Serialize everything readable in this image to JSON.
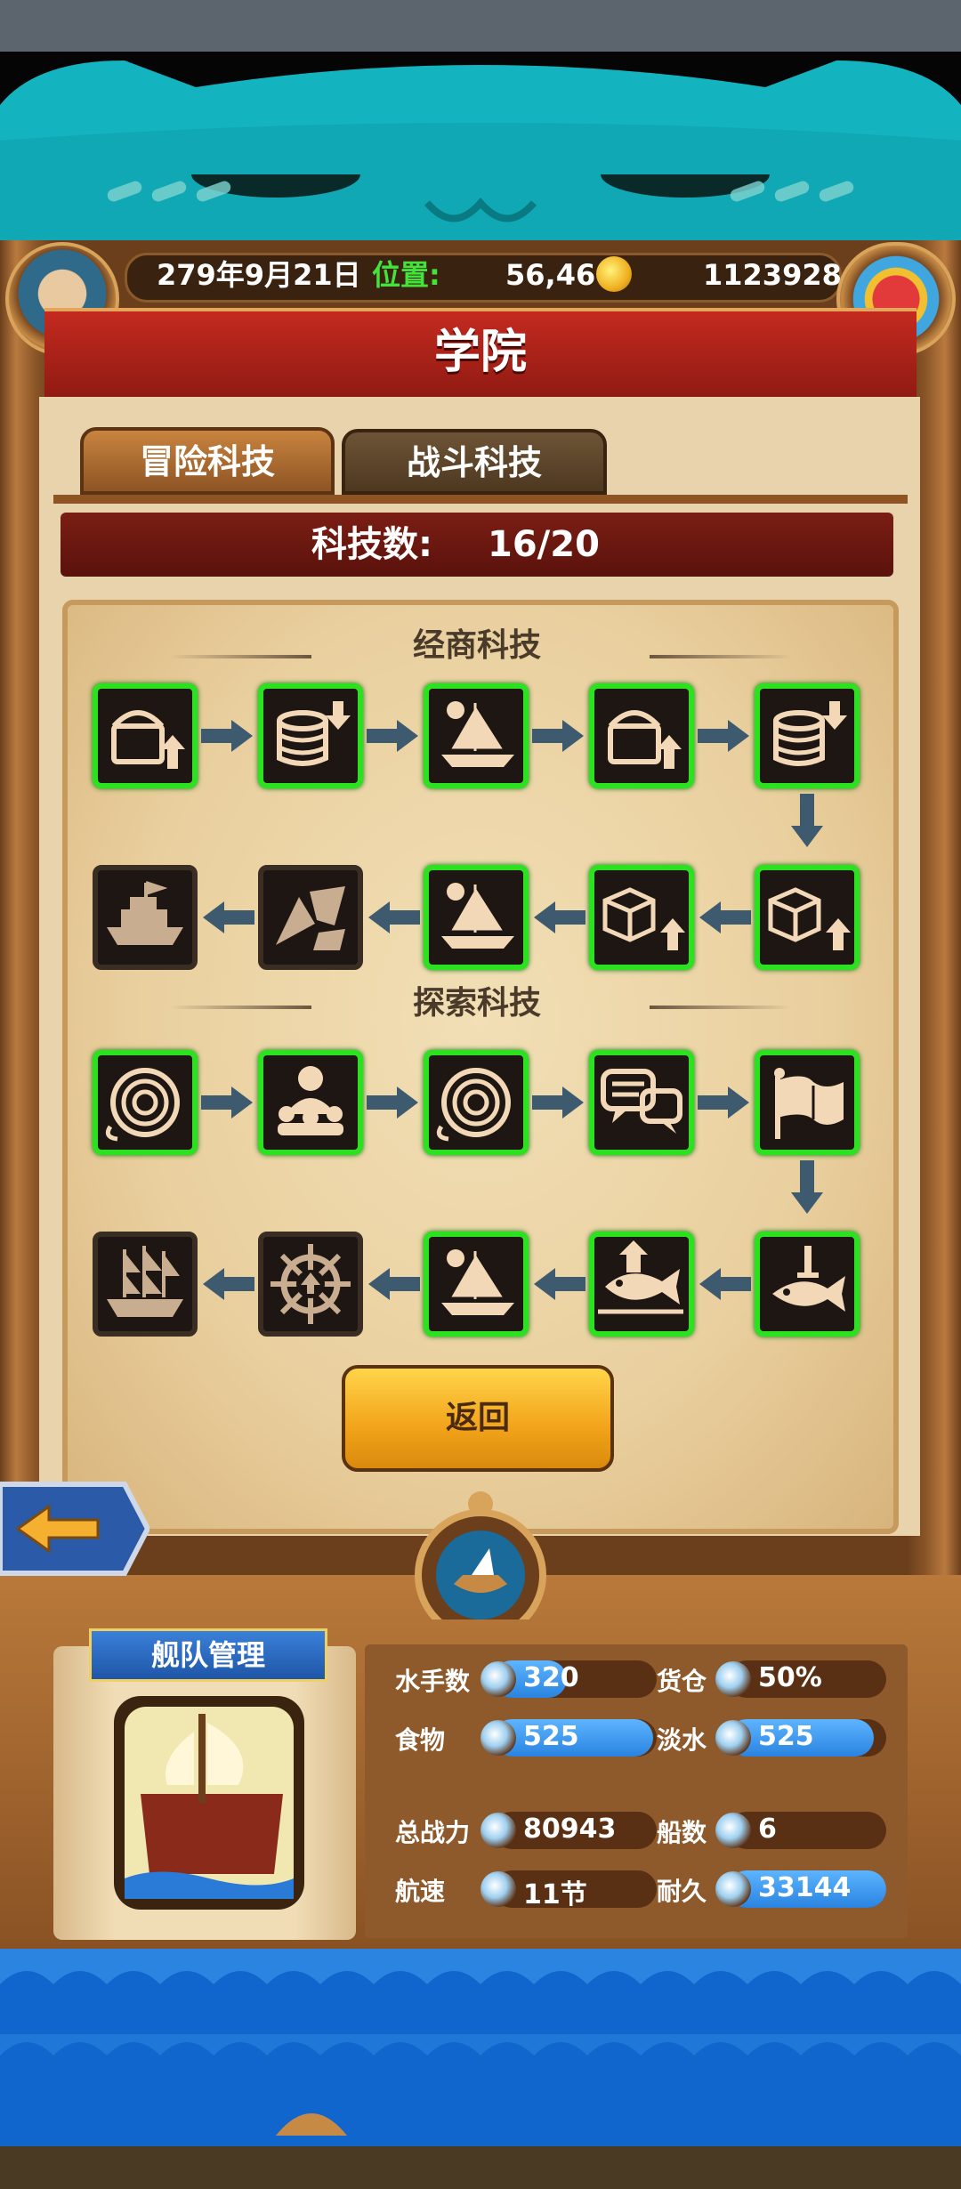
{
  "hud": {
    "date": "279年9月21日",
    "position_label": "位置:",
    "position_value": "56,46",
    "gold": "1123928"
  },
  "title": "学院",
  "tabs": [
    {
      "label": "冒险科技",
      "active": true
    },
    {
      "label": "战斗科技",
      "active": false
    }
  ],
  "tech_count": {
    "label": "科技数:",
    "value": "16/20"
  },
  "sections": [
    {
      "title": "经商科技",
      "rows": [
        [
          {
            "icon": "treasure-chest-up-icon",
            "unlocked": true
          },
          {
            "icon": "coin-stack-down-icon",
            "unlocked": true
          },
          {
            "icon": "sailing-ship-icon",
            "unlocked": true
          },
          {
            "icon": "treasure-chest-up-icon",
            "unlocked": true
          },
          {
            "icon": "coin-stack-down-icon",
            "unlocked": true
          }
        ],
        [
          {
            "icon": "steam-ship-icon",
            "unlocked": false
          },
          {
            "icon": "broken-ship-icon",
            "unlocked": false
          },
          {
            "icon": "sailing-ship-icon",
            "unlocked": true
          },
          {
            "icon": "crates-up-icon",
            "unlocked": true
          },
          {
            "icon": "crates-up-icon",
            "unlocked": true
          }
        ]
      ]
    },
    {
      "title": "探索科技",
      "rows": [
        [
          {
            "icon": "rope-coil-icon",
            "unlocked": true
          },
          {
            "icon": "crew-icon",
            "unlocked": true
          },
          {
            "icon": "rope-coil-icon",
            "unlocked": true
          },
          {
            "icon": "speech-bubbles-icon",
            "unlocked": true
          },
          {
            "icon": "flag-icon",
            "unlocked": true
          }
        ],
        [
          {
            "icon": "galleon-icon",
            "unlocked": false
          },
          {
            "icon": "ship-wheel-up-icon",
            "unlocked": false
          },
          {
            "icon": "sailing-ship-icon",
            "unlocked": true
          },
          {
            "icon": "fish-up-icon",
            "unlocked": true
          },
          {
            "icon": "fish-sword-icon",
            "unlocked": true
          }
        ]
      ]
    }
  ],
  "back_button": "返回",
  "fleet": {
    "title": "舰队管理",
    "stats": [
      {
        "label": "水手数",
        "value": "320",
        "fill": 0.45,
        "icon": "sailor-icon"
      },
      {
        "label": "货仓",
        "value": "50%",
        "fill": 0.0,
        "icon": "cargo-icon"
      },
      {
        "label": "食物",
        "value": "525",
        "fill": 0.98,
        "icon": "meat-icon"
      },
      {
        "label": "淡水",
        "value": "525",
        "fill": 0.92,
        "icon": "water-jug-icon"
      },
      {
        "label": "总战力",
        "value": "80943",
        "fill": 0.0,
        "icon": "skull-swords-icon"
      },
      {
        "label": "船数",
        "value": "6",
        "fill": 0.0,
        "icon": "boat-icon"
      },
      {
        "label": "航速",
        "value": "11节",
        "fill": 0.0,
        "icon": "speed-ship-icon"
      },
      {
        "label": "耐久",
        "value": "33144",
        "fill": 1.0,
        "icon": "durability-icon"
      }
    ]
  },
  "colors": {
    "unlocked_border": "#2ce11f",
    "locked_border": "#3a2e24",
    "title_banner": "#b3231a",
    "button": "#f5b323",
    "sea": "#1066cc"
  }
}
